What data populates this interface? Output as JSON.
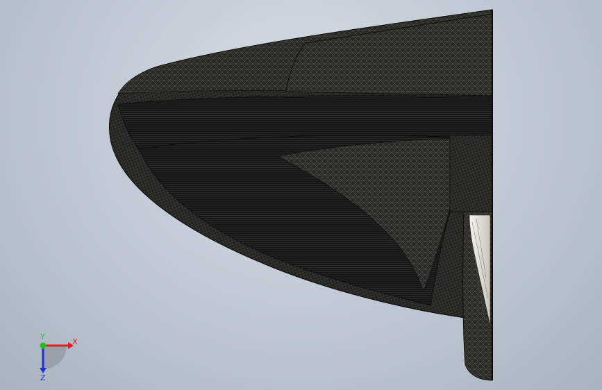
{
  "viewport": {
    "background_top": "#d6dde5",
    "background_bottom": "#a9b3be"
  },
  "model": {
    "description_icon": "mesh-shell-icon",
    "mesh_color": "#1c1c1a",
    "highlight_color": "#55564f",
    "inner_color": "#e8e6dc"
  },
  "triad": {
    "x_label": "X",
    "y_label": "Y",
    "z_label": "Z",
    "x_color": "#e02020",
    "y_color": "#20c020",
    "z_color": "#2030d0"
  }
}
